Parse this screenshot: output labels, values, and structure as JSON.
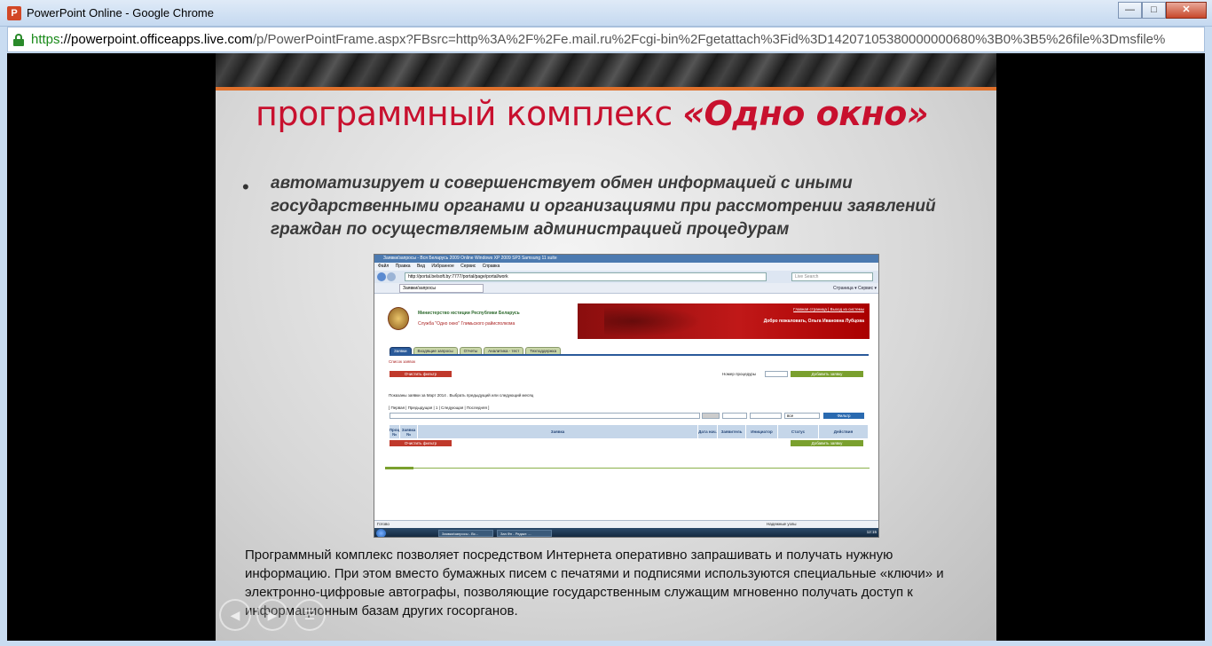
{
  "window": {
    "title": "PowerPoint Online - Google Chrome",
    "app_icon_letter": "P",
    "minimize": "—",
    "maximize": "□",
    "close": "✕"
  },
  "address": {
    "scheme": "https",
    "host": "://powerpoint.officeapps.live.com",
    "path": "/p/PowerPointFrame.aspx?FBsrc=http%3A%2F%2Fe.mail.ru%2Fcgi-bin%2Fgetattach%3Fid%3D14207105380000000680%3B0%3B5%26file%3Dmsfile%"
  },
  "slide": {
    "title_plain": "программный комплекс ",
    "title_emph": "«Одно окно»",
    "bullet": "автоматизирует и совершенствует обмен информацией с иными государственными органами и организациями при рассмотрении заявлений граждан по осуществляемым администрацией процедурам",
    "body": "Программный комплекс позволяет посредством Интернета оперативно запрашивать и получать нужную информацию. При этом вместо бумажных писем с печатями и подписями используются специальные «ключи» и электронно-цифровые автографы, позволяющие государственным служащим мгновенно получать доступ к информационным базам других госорганов."
  },
  "screenshot": {
    "ie_title": "Заявки/запросы - Вся Беларусь 2009 Online Windows XP 2009 SP3 Samsung 11 suite",
    "menu": [
      "Файл",
      "Правка",
      "Вид",
      "Избранное",
      "Сервис",
      "Справка"
    ],
    "url": "http://portal.belsoft.by:7777/portal/page/portal/work",
    "search_placeholder": "Live Search",
    "tab": "Заявки/запросы",
    "tools": "Страница ▾  Сервис ▾",
    "org": "Министерство юстиции Республики Беларусь",
    "service": "Служба \"Одно окно\" Глимьского райисполкома",
    "links": "Главная страница | Выход из системы",
    "welcome": "Добро пожаловать, Ольга Ивановна Лубцова",
    "tabs": [
      "Заявки",
      "Входящие запросы",
      "Отчеты",
      "Аналитика - тест",
      "Техподдержка"
    ],
    "crumb": "Список заявок",
    "clear_filter": "Очистить фильтр",
    "proc_number": "Номер процедуры",
    "add_request": "Добавить заявку",
    "shown": "Показаны заявки за Март 2014 . Выбрать предыдущий или следующий месяц",
    "pager": "[ Первая | Предыдущая | 1 | Следующая | Последняя ]",
    "select_all": "все",
    "filter": "Фильтр",
    "columns": [
      "Проц №",
      "Заявка №",
      "Заявка",
      "Дата нач.",
      "Заявитель",
      "Инициатор",
      "Статус",
      "Действия"
    ],
    "status_left": "Готово",
    "status_right": "Надежные узлы",
    "task_items": [
      "Заявки/запросы - Вс...",
      "Зап.Фн - Редакт. ..."
    ],
    "clock": "12:15"
  },
  "nav": {
    "prev": "◀",
    "next": "▶",
    "menu": "☰"
  }
}
